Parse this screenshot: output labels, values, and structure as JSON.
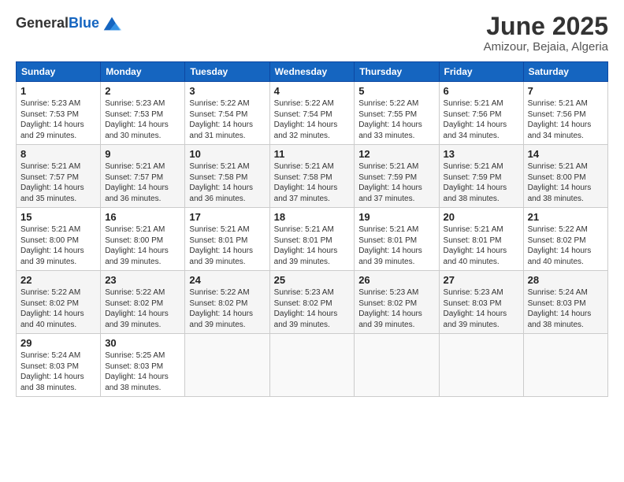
{
  "header": {
    "logo_general": "General",
    "logo_blue": "Blue",
    "title": "June 2025",
    "subtitle": "Amizour, Bejaia, Algeria"
  },
  "weekdays": [
    "Sunday",
    "Monday",
    "Tuesday",
    "Wednesday",
    "Thursday",
    "Friday",
    "Saturday"
  ],
  "weeks": [
    [
      {
        "day": "1",
        "info": "Sunrise: 5:23 AM\nSunset: 7:53 PM\nDaylight: 14 hours\nand 29 minutes."
      },
      {
        "day": "2",
        "info": "Sunrise: 5:23 AM\nSunset: 7:53 PM\nDaylight: 14 hours\nand 30 minutes."
      },
      {
        "day": "3",
        "info": "Sunrise: 5:22 AM\nSunset: 7:54 PM\nDaylight: 14 hours\nand 31 minutes."
      },
      {
        "day": "4",
        "info": "Sunrise: 5:22 AM\nSunset: 7:54 PM\nDaylight: 14 hours\nand 32 minutes."
      },
      {
        "day": "5",
        "info": "Sunrise: 5:22 AM\nSunset: 7:55 PM\nDaylight: 14 hours\nand 33 minutes."
      },
      {
        "day": "6",
        "info": "Sunrise: 5:21 AM\nSunset: 7:56 PM\nDaylight: 14 hours\nand 34 minutes."
      },
      {
        "day": "7",
        "info": "Sunrise: 5:21 AM\nSunset: 7:56 PM\nDaylight: 14 hours\nand 34 minutes."
      }
    ],
    [
      {
        "day": "8",
        "info": "Sunrise: 5:21 AM\nSunset: 7:57 PM\nDaylight: 14 hours\nand 35 minutes."
      },
      {
        "day": "9",
        "info": "Sunrise: 5:21 AM\nSunset: 7:57 PM\nDaylight: 14 hours\nand 36 minutes."
      },
      {
        "day": "10",
        "info": "Sunrise: 5:21 AM\nSunset: 7:58 PM\nDaylight: 14 hours\nand 36 minutes."
      },
      {
        "day": "11",
        "info": "Sunrise: 5:21 AM\nSunset: 7:58 PM\nDaylight: 14 hours\nand 37 minutes."
      },
      {
        "day": "12",
        "info": "Sunrise: 5:21 AM\nSunset: 7:59 PM\nDaylight: 14 hours\nand 37 minutes."
      },
      {
        "day": "13",
        "info": "Sunrise: 5:21 AM\nSunset: 7:59 PM\nDaylight: 14 hours\nand 38 minutes."
      },
      {
        "day": "14",
        "info": "Sunrise: 5:21 AM\nSunset: 8:00 PM\nDaylight: 14 hours\nand 38 minutes."
      }
    ],
    [
      {
        "day": "15",
        "info": "Sunrise: 5:21 AM\nSunset: 8:00 PM\nDaylight: 14 hours\nand 39 minutes."
      },
      {
        "day": "16",
        "info": "Sunrise: 5:21 AM\nSunset: 8:00 PM\nDaylight: 14 hours\nand 39 minutes."
      },
      {
        "day": "17",
        "info": "Sunrise: 5:21 AM\nSunset: 8:01 PM\nDaylight: 14 hours\nand 39 minutes."
      },
      {
        "day": "18",
        "info": "Sunrise: 5:21 AM\nSunset: 8:01 PM\nDaylight: 14 hours\nand 39 minutes."
      },
      {
        "day": "19",
        "info": "Sunrise: 5:21 AM\nSunset: 8:01 PM\nDaylight: 14 hours\nand 39 minutes."
      },
      {
        "day": "20",
        "info": "Sunrise: 5:21 AM\nSunset: 8:01 PM\nDaylight: 14 hours\nand 40 minutes."
      },
      {
        "day": "21",
        "info": "Sunrise: 5:22 AM\nSunset: 8:02 PM\nDaylight: 14 hours\nand 40 minutes."
      }
    ],
    [
      {
        "day": "22",
        "info": "Sunrise: 5:22 AM\nSunset: 8:02 PM\nDaylight: 14 hours\nand 40 minutes."
      },
      {
        "day": "23",
        "info": "Sunrise: 5:22 AM\nSunset: 8:02 PM\nDaylight: 14 hours\nand 39 minutes."
      },
      {
        "day": "24",
        "info": "Sunrise: 5:22 AM\nSunset: 8:02 PM\nDaylight: 14 hours\nand 39 minutes."
      },
      {
        "day": "25",
        "info": "Sunrise: 5:23 AM\nSunset: 8:02 PM\nDaylight: 14 hours\nand 39 minutes."
      },
      {
        "day": "26",
        "info": "Sunrise: 5:23 AM\nSunset: 8:02 PM\nDaylight: 14 hours\nand 39 minutes."
      },
      {
        "day": "27",
        "info": "Sunrise: 5:23 AM\nSunset: 8:03 PM\nDaylight: 14 hours\nand 39 minutes."
      },
      {
        "day": "28",
        "info": "Sunrise: 5:24 AM\nSunset: 8:03 PM\nDaylight: 14 hours\nand 38 minutes."
      }
    ],
    [
      {
        "day": "29",
        "info": "Sunrise: 5:24 AM\nSunset: 8:03 PM\nDaylight: 14 hours\nand 38 minutes."
      },
      {
        "day": "30",
        "info": "Sunrise: 5:25 AM\nSunset: 8:03 PM\nDaylight: 14 hours\nand 38 minutes."
      },
      null,
      null,
      null,
      null,
      null
    ]
  ]
}
